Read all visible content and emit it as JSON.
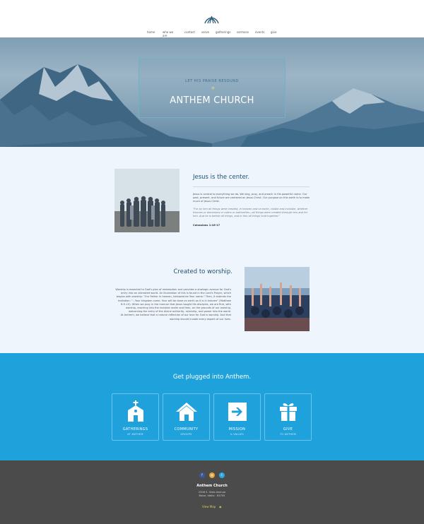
{
  "header": {
    "logo_icon": "anthem-arch-logo",
    "nav": [
      {
        "label": "home"
      },
      {
        "label": "who we are"
      },
      {
        "label": "contact"
      },
      {
        "label": "serve"
      },
      {
        "label": "gatherings"
      },
      {
        "label": "sermons"
      },
      {
        "label": "events"
      },
      {
        "label": "give"
      }
    ]
  },
  "hero": {
    "subtitle": "LET HIS PRAISE RESOUND",
    "plus": "+",
    "title": "ANTHEM CHURCH"
  },
  "about": {
    "center": {
      "heading": "Jesus is the center.",
      "body": "Jesus is central to everything we do. We sing, pray, and preach in His powerful name. Our past, present, and future are centered on Jesus Christ. Our purpose on this earth is to make much of Jesus Christ.",
      "quote": "\"For by him all things were created, in heaven and on earth, visible and invisible, whether thrones or dominions or rulers or authorities—all things were created through him and for him. And he is before all things, and in him all things hold together.\"",
      "reference": "Colossians 1:16-17"
    },
    "worship": {
      "heading": "Created to worship.",
      "body": "Worship is essential to God's plan of redemption and provides a strategic avenue for God's entry into an alienated world. An illustration of this is found in the Lord's Prayer, which begins with worship: \"Our Father in heaven, hallowed be Your name.\" Then, it extends the invitation: \"...Your kingdom come. Your will be done on earth as it is in heaven\" (Matthew 6:9–10). When we pray in the manner that Jesus taught His disciples, we are first, with worship, reaching into the invisible realm and then, on the grounds of our worship, welcoming the entry of the divine authority, rulership, and power into the world.",
      "body2": "At Anthem, we believe that a natural reflection of our love for God is worship. And that worship should invade every aspect of our lives."
    }
  },
  "plugged": {
    "title": "Get plugged into Anthem.",
    "cards": [
      {
        "label": "GATHERINGS",
        "sub": "AT ANTHEM",
        "icon": "church-icon"
      },
      {
        "label": "COMMUNITY",
        "sub": "GROUPS",
        "icon": "house-icon"
      },
      {
        "label": "MISSION",
        "sub": "& VALUES",
        "icon": "arrow-right-box-icon"
      },
      {
        "label": "GIVE",
        "sub": "TO ANTHEM",
        "icon": "gift-icon"
      }
    ]
  },
  "footer": {
    "social": [
      {
        "icon": "facebook-icon",
        "glyph": "f",
        "color": "#3b5998"
      },
      {
        "icon": "email-icon",
        "glyph": "@",
        "color": "#e0a53a"
      },
      {
        "icon": "twitter-icon",
        "glyph": "t",
        "color": "#2aa9e0"
      }
    ],
    "name": "Anthem Church",
    "address_line1": "2306 S. Vista Avenue",
    "address_line2": "Boise, Idaho · 83705",
    "map_label": "View Map",
    "map_icon": "map-pin-icon"
  }
}
